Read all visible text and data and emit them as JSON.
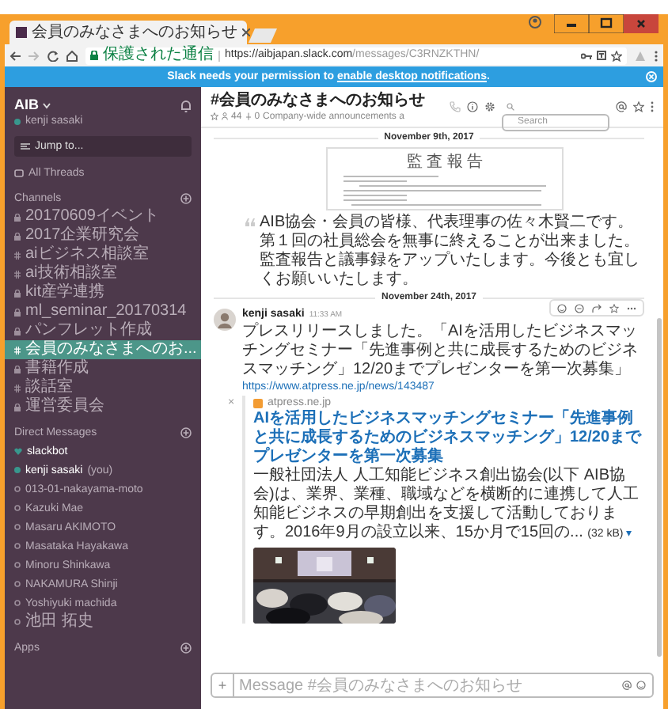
{
  "browser": {
    "tab_title": "会員のみなさまへのお知らせ",
    "secure_label": "保護された通信",
    "url_host": "https://aibjapan.slack.com",
    "url_path": "/messages/C3RNZKTHN/"
  },
  "banner": {
    "text": "Slack needs your permission to ",
    "link": "enable desktop notifications",
    "end": "."
  },
  "sidebar": {
    "team": "AIB",
    "user": "kenji sasaki",
    "jump": "Jump to...",
    "threads": "All Threads",
    "channels_heading": "Channels",
    "channels": [
      {
        "name": "20170609イベント",
        "kind": "private",
        "selected": false
      },
      {
        "name": "2017企業研究会",
        "kind": "private",
        "selected": false
      },
      {
        "name": "aiビジネス相談室",
        "kind": "public",
        "selected": false
      },
      {
        "name": "ai技術相談室",
        "kind": "public",
        "selected": false
      },
      {
        "name": "kit産学連携",
        "kind": "private",
        "selected": false
      },
      {
        "name": "ml_seminar_20170314",
        "kind": "private",
        "selected": false
      },
      {
        "name": "パンフレット作成",
        "kind": "private",
        "selected": false
      },
      {
        "name": "会員のみなさまへのお...",
        "kind": "public",
        "selected": true
      },
      {
        "name": "書籍作成",
        "kind": "private",
        "selected": false
      },
      {
        "name": "談話室",
        "kind": "public",
        "selected": false
      },
      {
        "name": "運営委員会",
        "kind": "private",
        "selected": false
      }
    ],
    "dm_heading": "Direct Messages",
    "dms": [
      {
        "name": "slackbot",
        "kind": "bot"
      },
      {
        "name": "kenji sasaki",
        "suffix": "(you)",
        "kind": "person",
        "online": true
      },
      {
        "name": "013-01-nakayama-moto",
        "kind": "person",
        "online": false
      },
      {
        "name": "Kazuki Mae",
        "kind": "person",
        "online": false
      },
      {
        "name": "Masaru AKIMOTO",
        "kind": "person",
        "online": false
      },
      {
        "name": "Masataka Hayakawa",
        "kind": "person",
        "online": false
      },
      {
        "name": "Minoru Shinkawa",
        "kind": "person",
        "online": false
      },
      {
        "name": "NAKAMURA Shinji",
        "kind": "person",
        "online": false
      },
      {
        "name": "Yoshiyuki machida",
        "kind": "person",
        "online": false
      },
      {
        "name": "池田 拓史",
        "kind": "person",
        "online": false
      }
    ],
    "apps_heading": "Apps"
  },
  "header": {
    "title": "#会員のみなさまへのお知らせ",
    "members": "44",
    "pins": "0",
    "topic": "Company-wide announcements a",
    "search_placeholder": "Search"
  },
  "messages": {
    "date_1": "November 9th, 2017",
    "document_title": "監 査 報 告",
    "quote": "AIB協会・会員の皆様、代表理事の佐々木賢二です。第１回の社員総会を無事に終えることが出来ました。監査報告と議事録をアップいたします。今後とも宜しくお願いいたします。",
    "date_2": "November 24th, 2017",
    "author": "kenji sasaki",
    "time": "11:33 AM",
    "text": "プレスリリースしました。「AIを活用したビジネスマッチングセミナー「先進事例と共に成長するためのビジネスマッチング」12/20までプレゼンターを第一次募集」",
    "link": "https://www.atpress.ne.jp/news/143487",
    "attachment": {
      "close": "×",
      "site": "atpress.ne.jp",
      "title": "AIを活用したビジネスマッチングセミナー「先進事例と共に成長するためのビジネスマッチング」12/20までプレゼンターを第一次募集",
      "description": "一般社団法人 人工知能ビジネス創出協会(以下 AIB協会)は、業界、業種、職域などを横断的に連携して人工知能ビジネスの早期創出を支援して活動しております。2016年9月の設立以来、15か月で15回の...",
      "size": "(32 kB)",
      "expand": "▾"
    }
  },
  "composer": {
    "plus": "+",
    "placeholder": "Message #会員のみなさまへのお知らせ"
  }
}
